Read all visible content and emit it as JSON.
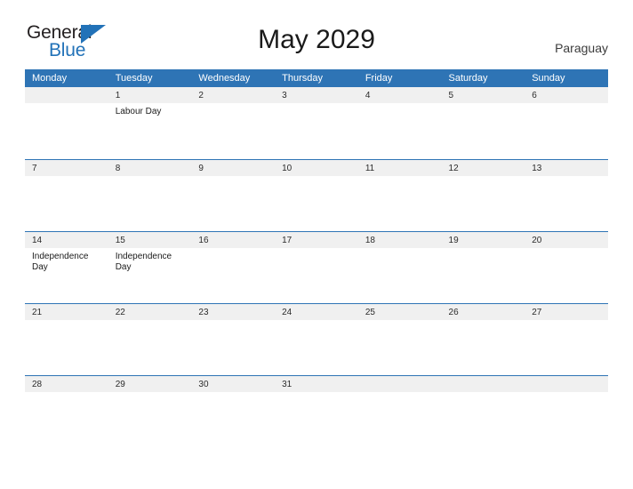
{
  "logo": {
    "text_top": "General",
    "text_bottom": "Blue",
    "icon": "flag-triangle-icon",
    "accent_color": "#2272b8"
  },
  "header": {
    "title": "May 2029",
    "country": "Paraguay"
  },
  "theme": {
    "header_blue": "#2e74b5",
    "date_band": "#f0f0f0",
    "text": "#1a1a1a"
  },
  "calendar": {
    "weekday_headers": [
      "Monday",
      "Tuesday",
      "Wednesday",
      "Thursday",
      "Friday",
      "Saturday",
      "Sunday"
    ],
    "weeks": [
      [
        {
          "day": "",
          "event": ""
        },
        {
          "day": "1",
          "event": "Labour Day"
        },
        {
          "day": "2",
          "event": ""
        },
        {
          "day": "3",
          "event": ""
        },
        {
          "day": "4",
          "event": ""
        },
        {
          "day": "5",
          "event": ""
        },
        {
          "day": "6",
          "event": ""
        }
      ],
      [
        {
          "day": "7",
          "event": ""
        },
        {
          "day": "8",
          "event": ""
        },
        {
          "day": "9",
          "event": ""
        },
        {
          "day": "10",
          "event": ""
        },
        {
          "day": "11",
          "event": ""
        },
        {
          "day": "12",
          "event": ""
        },
        {
          "day": "13",
          "event": ""
        }
      ],
      [
        {
          "day": "14",
          "event": "Independence Day"
        },
        {
          "day": "15",
          "event": "Independence Day"
        },
        {
          "day": "16",
          "event": ""
        },
        {
          "day": "17",
          "event": ""
        },
        {
          "day": "18",
          "event": ""
        },
        {
          "day": "19",
          "event": ""
        },
        {
          "day": "20",
          "event": ""
        }
      ],
      [
        {
          "day": "21",
          "event": ""
        },
        {
          "day": "22",
          "event": ""
        },
        {
          "day": "23",
          "event": ""
        },
        {
          "day": "24",
          "event": ""
        },
        {
          "day": "25",
          "event": ""
        },
        {
          "day": "26",
          "event": ""
        },
        {
          "day": "27",
          "event": ""
        }
      ],
      [
        {
          "day": "28",
          "event": ""
        },
        {
          "day": "29",
          "event": ""
        },
        {
          "day": "30",
          "event": ""
        },
        {
          "day": "31",
          "event": ""
        },
        {
          "day": "",
          "event": ""
        },
        {
          "day": "",
          "event": ""
        },
        {
          "day": "",
          "event": ""
        }
      ]
    ]
  }
}
